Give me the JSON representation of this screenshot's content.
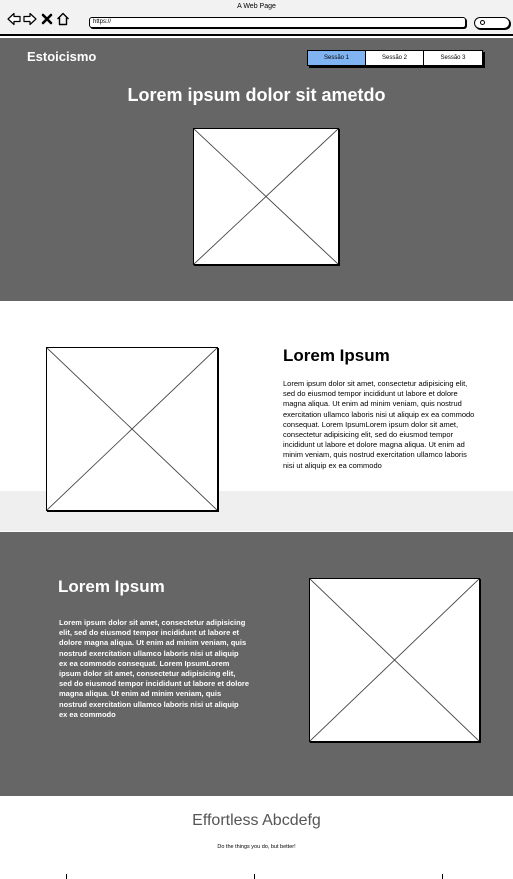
{
  "browser": {
    "window_title": "A Web Page",
    "url": "https://",
    "icons": [
      "back-arrow-icon",
      "forward-arrow-icon",
      "close-icon",
      "home-icon",
      "search-icon"
    ]
  },
  "header": {
    "brand": "Estoicismo",
    "tabs": [
      {
        "label": "Sessão 1",
        "active": true
      },
      {
        "label": "Sessão 2",
        "active": false
      },
      {
        "label": "Sessão 3",
        "active": false
      }
    ],
    "hero_title": "Lorem ipsum dolor sit ametdo"
  },
  "section_one": {
    "title": "Lorem Ipsum",
    "body": " Lorem ipsum dolor sit amet, consectetur adipisicing elit, sed do eiusmod tempor incididunt ut labore et dolore magna aliqua. Ut enim ad minim veniam, quis nostrud exercitation ullamco laboris nisi ut aliquip ex ea commodo consequat. Lorem IpsumLorem ipsum dolor sit amet, consectetur adipisicing elit, sed do eiusmod tempor incididunt ut labore et dolore magna aliqua. Ut enim ad minim veniam, quis nostrud exercitation ullamco laboris nisi ut aliquip ex ea commodo"
  },
  "section_two": {
    "title": "Lorem Ipsum",
    "body": " Lorem ipsum dolor sit amet, consectetur adipisicing elit, sed do eiusmod tempor incididunt ut labore et dolore magna aliqua. Ut enim ad minim veniam, quis nostrud exercitation ullamco laboris nisi ut aliquip ex ea commodo consequat. Lorem IpsumLorem ipsum dolor sit amet, consectetur adipisicing elit, sed do eiusmod tempor incididunt ut labore et dolore magna aliqua. Ut enim ad minim veniam, quis nostrud exercitation ullamco laboris nisi ut aliquip ex ea commodo"
  },
  "footer": {
    "title": "Effortless Abcdefg",
    "subtitle": "Do the things you do, but better!"
  },
  "colors": {
    "dark_section": "#666666",
    "active_tab": "#80b3f2",
    "light_strip": "#efefef"
  }
}
